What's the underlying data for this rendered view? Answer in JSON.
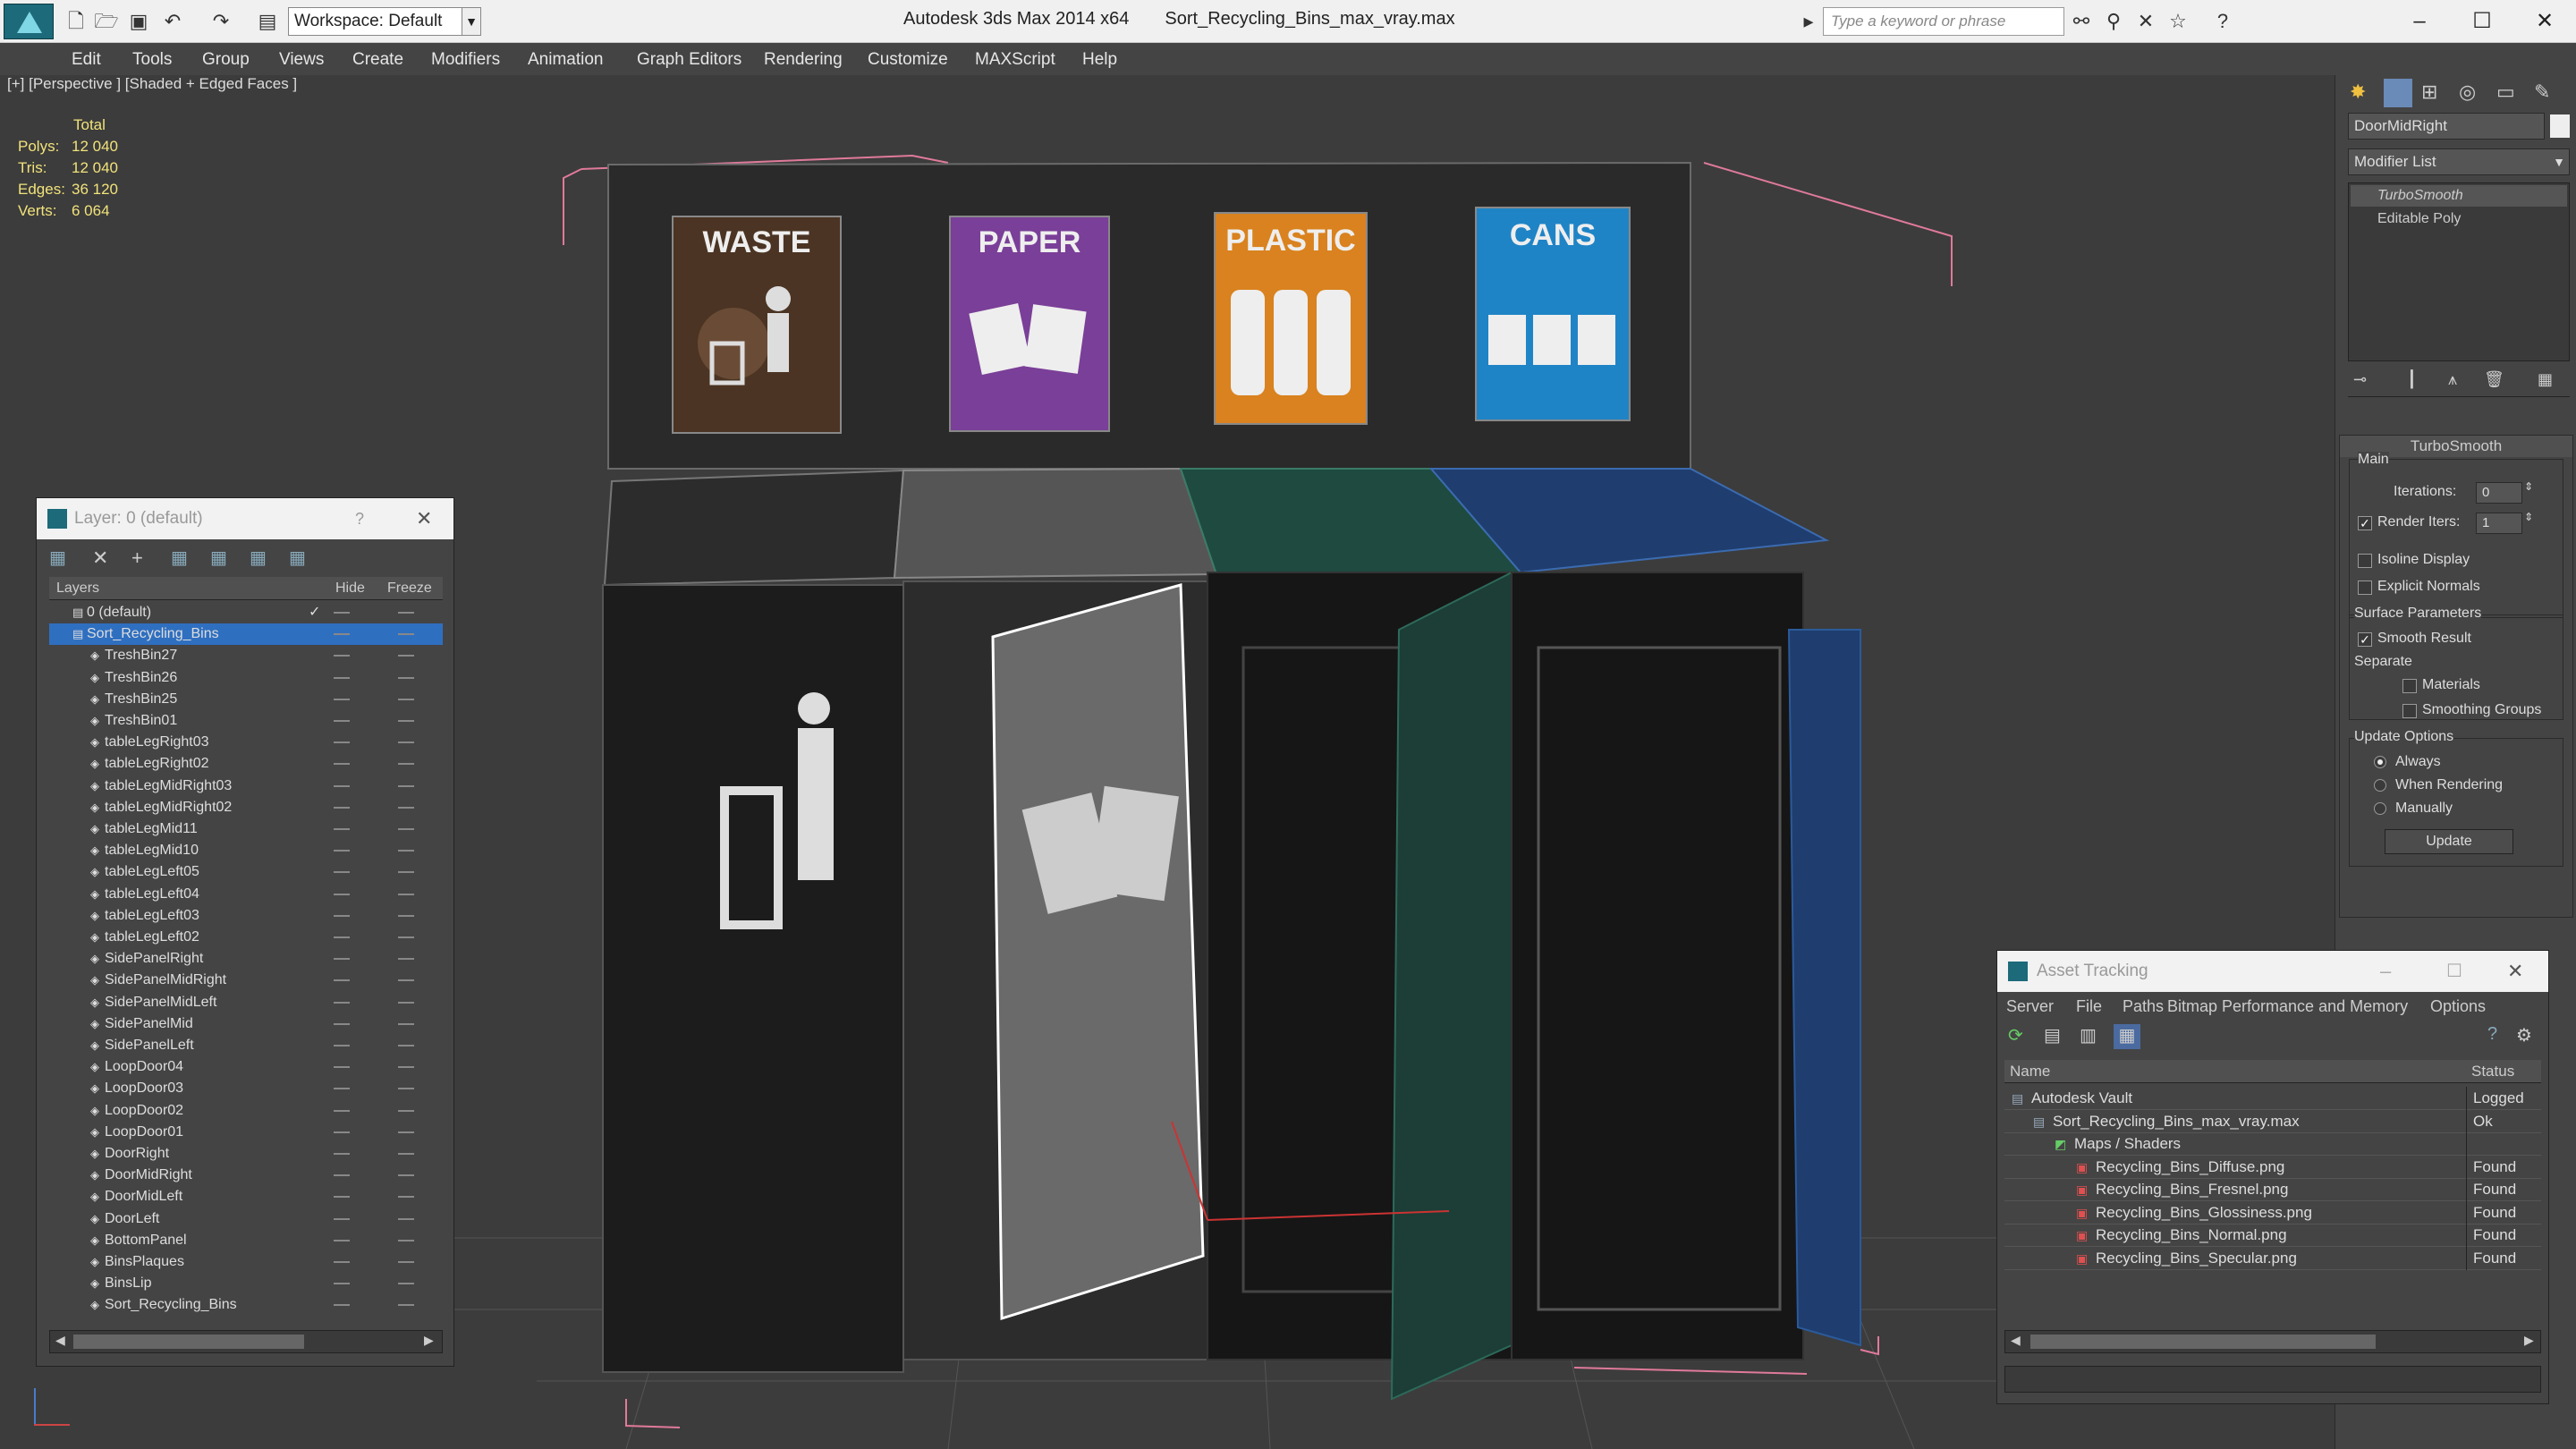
{
  "window": {
    "app_title": "Autodesk 3ds Max 2014 x64",
    "file_title": "Sort_Recycling_Bins_max_vray.max",
    "workspace": "Workspace: Default",
    "search_placeholder": "Type a keyword or phrase"
  },
  "menu": [
    "Edit",
    "Tools",
    "Group",
    "Views",
    "Create",
    "Modifiers",
    "Animation",
    "Graph Editors",
    "Rendering",
    "Customize",
    "MAXScript",
    "Help"
  ],
  "viewport": {
    "label": "[+] [Perspective ] [Shaded + Edged Faces ]",
    "stats": {
      "header": "Total",
      "rows": [
        {
          "k": "Polys:",
          "v": "12 040"
        },
        {
          "k": "Tris:",
          "v": "12 040"
        },
        {
          "k": "Edges:",
          "v": "36 120"
        },
        {
          "k": "Verts:",
          "v": "6 064"
        }
      ]
    },
    "signs": [
      "WASTE",
      "PAPER",
      "PLASTIC",
      "CANS"
    ],
    "colors": {
      "waste": "#4b3423",
      "paper": "#7a3f98",
      "plastic": "#d9821f",
      "cans": "#1f84c6"
    }
  },
  "layer_window": {
    "title": "Layer: 0 (default)",
    "columns": [
      "Layers",
      "Hide",
      "Freeze"
    ],
    "rows": [
      "0 (default)",
      "Sort_Recycling_Bins",
      "TreshBin27",
      "TreshBin26",
      "TreshBin25",
      "TreshBin01",
      "tableLegRight03",
      "tableLegRight02",
      "tableLegMidRight03",
      "tableLegMidRight02",
      "tableLegMid11",
      "tableLegMid10",
      "tableLegLeft05",
      "tableLegLeft04",
      "tableLegLeft03",
      "tableLegLeft02",
      "SidePanelRight",
      "SidePanelMidRight",
      "SidePanelMidLeft",
      "SidePanelMid",
      "SidePanelLeft",
      "LoopDoor04",
      "LoopDoor03",
      "LoopDoor02",
      "LoopDoor01",
      "DoorRight",
      "DoorMidRight",
      "DoorMidLeft",
      "DoorLeft",
      "BottomPanel",
      "BinsPlaques",
      "BinsLip",
      "Sort_Recycling_Bins"
    ]
  },
  "command_panel": {
    "object_name": "DoorMidRight",
    "modifier_list": "Modifier List",
    "stack": [
      "TurboSmooth",
      "Editable Poly"
    ],
    "rollout_title": "TurboSmooth",
    "main_label": "Main",
    "iterations_label": "Iterations:",
    "iterations_value": "0",
    "render_iters_label": "Render Iters:",
    "render_iters_value": "1",
    "isoline": "Isoline Display",
    "explicit_normals": "Explicit Normals",
    "surface_params": "Surface Parameters",
    "smooth_result": "Smooth Result",
    "separate": "Separate",
    "materials": "Materials",
    "smoothing_groups": "Smoothing Groups",
    "update_options": "Update Options",
    "always": "Always",
    "when_rendering": "When Rendering",
    "manually": "Manually",
    "update_button": "Update"
  },
  "asset_tracking": {
    "title": "Asset Tracking",
    "menu": [
      "Server",
      "File",
      "Paths",
      "Bitmap Performance and Memory",
      "Options"
    ],
    "columns": [
      "Name",
      "Status"
    ],
    "rows": [
      {
        "name": "Autodesk Vault",
        "status": "Logged"
      },
      {
        "name": "Sort_Recycling_Bins_max_vray.max",
        "status": "Ok"
      },
      {
        "name": "Maps / Shaders",
        "status": ""
      },
      {
        "name": "Recycling_Bins_Diffuse.png",
        "status": "Found"
      },
      {
        "name": "Recycling_Bins_Fresnel.png",
        "status": "Found"
      },
      {
        "name": "Recycling_Bins_Glossiness.png",
        "status": "Found"
      },
      {
        "name": "Recycling_Bins_Normal.png",
        "status": "Found"
      },
      {
        "name": "Recycling_Bins_Specular.png",
        "status": "Found"
      }
    ]
  }
}
